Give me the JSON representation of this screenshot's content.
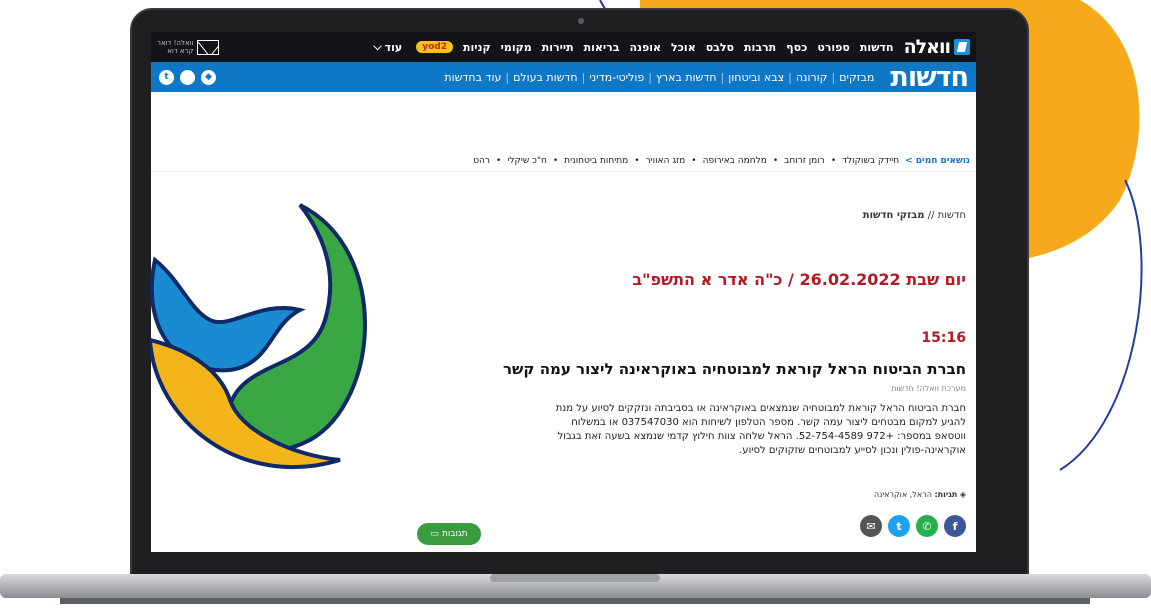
{
  "colors": {
    "accent_blue": "#0e77c6",
    "headline_red": "#b31a24",
    "brand_yellow": "#f6a91b",
    "green": "#3b9b3f"
  },
  "topbar": {
    "logo": "וואלה",
    "nav": [
      "חדשות",
      "ספורט",
      "כסף",
      "תרבות",
      "סלבס",
      "אוכל",
      "אופנה",
      "בריאות",
      "תיירות",
      "מקומי",
      "קניות"
    ],
    "yod_badge": "yod2",
    "more_label": "עוד",
    "mail_label": "וואלה! דואר",
    "mail_sub": "קרא דוא"
  },
  "subbar": {
    "section_title": "חדשות",
    "links": [
      "מבזקים",
      "קורונה",
      "צבא וביטחון",
      "חדשות בארץ",
      "פוליטי-מדיני",
      "חדשות בעולם",
      "עוד בחדשות"
    ],
    "social_icons": [
      "twitter-icon",
      "apple-icon",
      "android-icon"
    ]
  },
  "hot_topics": {
    "label": "נושאים חמים >",
    "items": [
      "חיידק בשוקולד",
      "רומן זרוחב",
      "מלחמה באירופה",
      "מזג האוויר",
      "מתיחות ביטחונית",
      "ח\"כ שיקלי",
      "רהט"
    ]
  },
  "breadcrumb": {
    "section": "חדשות //",
    "current": "מבזקי חדשות"
  },
  "article": {
    "date": "יום שבת 26.02.2022 / כ\"ה אדר א התשפ\"ב",
    "time": "15:16",
    "headline": "חברת הביטוח הראל קוראת למבוטחיה באוקראינה ליצור עמה קשר",
    "byline": "מערכת וואלה! חדשות",
    "body": "חברת הביטוח הראל קוראת למבוטחיה שנמצאים באוקראינה או בסביבתה ונזקקים לסיוע על מנת להגיע למקום מבטחים ליצור עמה קשר. מספר הטלפון לשיחות הוא 037547030 או במשלוח ווטסאפ במספר: +972 52-754-4589. הראל שלחה צוות חילוץ קדמי שנמצא בשעה זאת בגבול אוקראינה-פולין ונכון לסייע למבוטחים שזקוקים לסיוע.",
    "tags_label": "תגיות:",
    "tags": "הראל, אוקראינה",
    "comments_label": "תגובות"
  },
  "share_icons": [
    "facebook-icon",
    "whatsapp-icon",
    "twitter-icon",
    "mail-icon"
  ]
}
